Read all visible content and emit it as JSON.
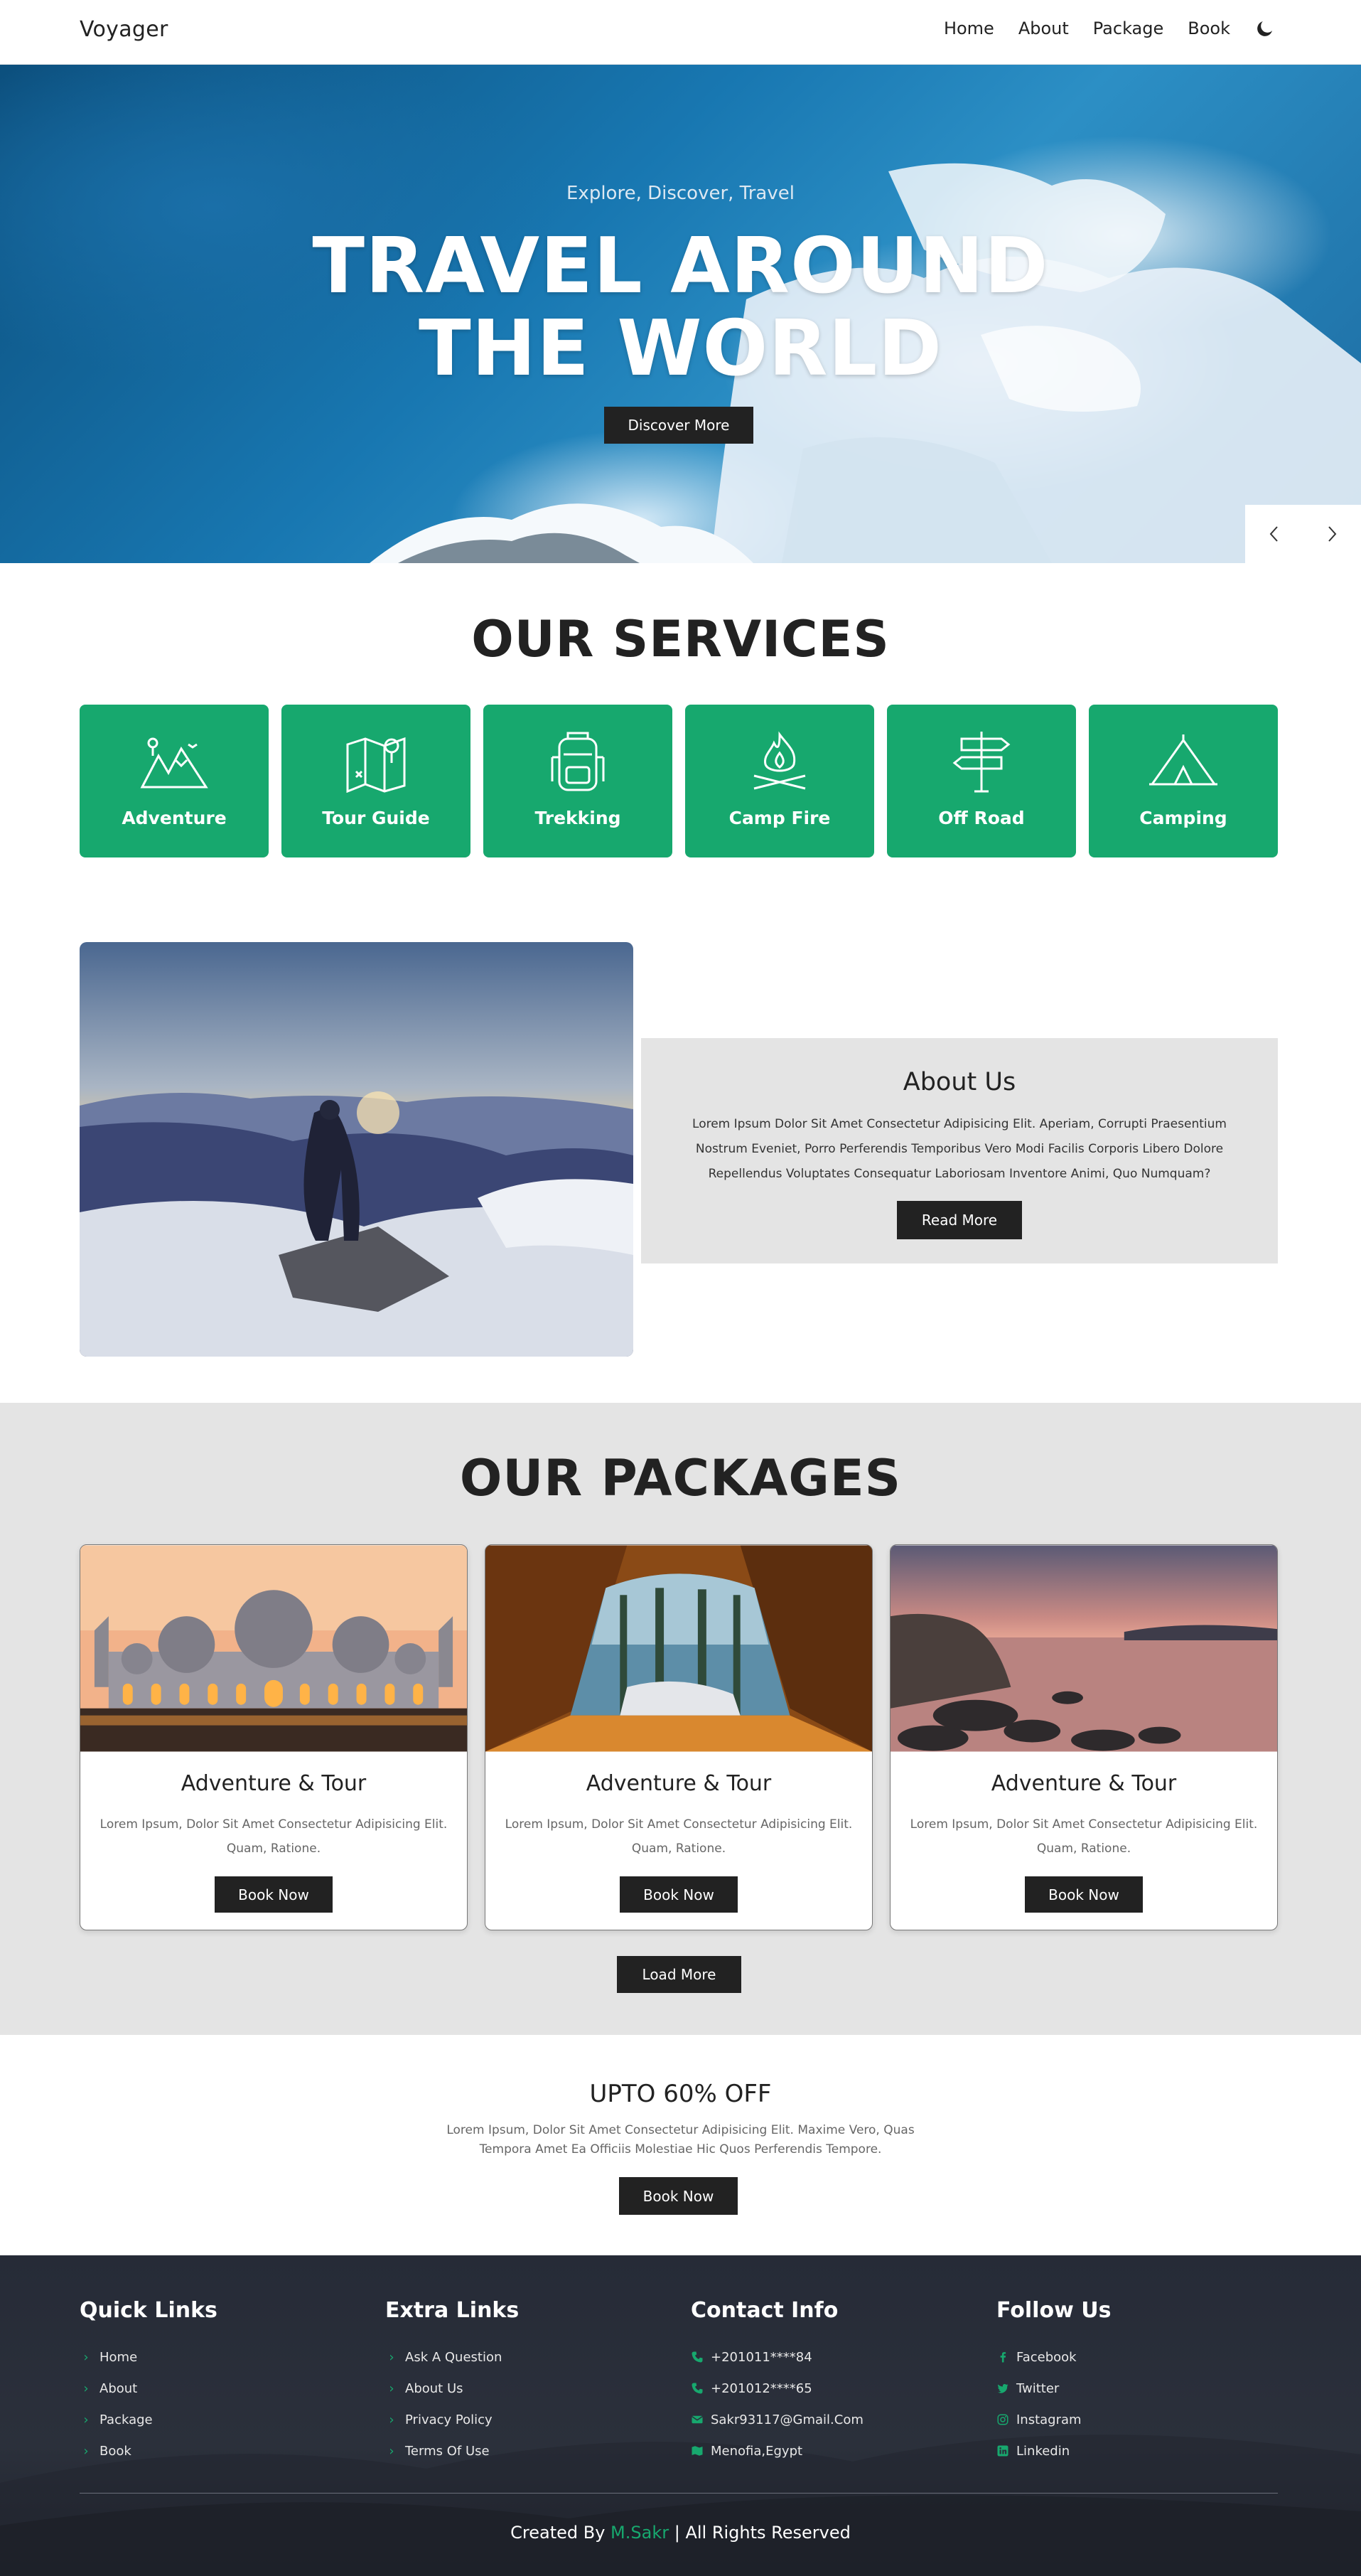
{
  "colors": {
    "accent": "#17a86e",
    "dark_button": "#222222",
    "footer_bg": "#2b303b",
    "section_gray": "#e4e4e4"
  },
  "nav": {
    "logo": "Voyager",
    "links": [
      "Home",
      "About",
      "Package",
      "Book"
    ],
    "theme_icon": "moon-icon"
  },
  "hero": {
    "subtitle": "Explore, Discover, Travel",
    "title_line1": "TRAVEL AROUND",
    "title_line2": "THE WORLD",
    "button": "Discover More",
    "prev_icon": "chevron-left-icon",
    "next_icon": "chevron-right-icon"
  },
  "services": {
    "title": "OUR SERVICES",
    "items": [
      {
        "label": "Adventure",
        "icon": "mountains-icon"
      },
      {
        "label": "Tour Guide",
        "icon": "map-pin-icon"
      },
      {
        "label": "Trekking",
        "icon": "backpack-icon"
      },
      {
        "label": "Camp Fire",
        "icon": "campfire-icon"
      },
      {
        "label": "Off Road",
        "icon": "signpost-icon"
      },
      {
        "label": "Camping",
        "icon": "tent-icon"
      }
    ]
  },
  "about": {
    "title": "About Us",
    "text": "Lorem Ipsum Dolor Sit Amet Consectetur Adipisicing Elit. Aperiam, Corrupti Praesentium Nostrum Eveniet, Porro Perferendis Temporibus Vero Modi Facilis Corporis Libero Dolore Repellendus Voluptates Consequatur Laboriosam Inventore Animi, Quo Numquam?",
    "button": "Read More"
  },
  "packages": {
    "title": "OUR PACKAGES",
    "items": [
      {
        "title": "Adventure & Tour",
        "desc": "Lorem Ipsum, Dolor Sit Amet Consectetur Adipisicing Elit. Quam, Ratione.",
        "button": "Book Now"
      },
      {
        "title": "Adventure & Tour",
        "desc": "Lorem Ipsum, Dolor Sit Amet Consectetur Adipisicing Elit. Quam, Ratione.",
        "button": "Book Now"
      },
      {
        "title": "Adventure & Tour",
        "desc": "Lorem Ipsum, Dolor Sit Amet Consectetur Adipisicing Elit. Quam, Ratione.",
        "button": "Book Now"
      }
    ],
    "load_more": "Load More"
  },
  "offer": {
    "title": "UPTO 60% OFF",
    "text": "Lorem Ipsum, Dolor Sit Amet Consectetur Adipisicing Elit. Maxime Vero, Quas Tempora Amet Ea Officiis Molestiae Hic Quos Perferendis Tempore.",
    "button": "Book Now"
  },
  "footer": {
    "quick_links": {
      "title": "Quick Links",
      "items": [
        "Home",
        "About",
        "Package",
        "Book"
      ]
    },
    "extra_links": {
      "title": "Extra Links",
      "items": [
        "Ask A Question",
        "About Us",
        "Privacy Policy",
        "Terms Of Use"
      ]
    },
    "contact": {
      "title": "Contact Info",
      "items": [
        {
          "text": "+201011****84",
          "icon": "phone-icon"
        },
        {
          "text": "+201012****65",
          "icon": "phone-icon"
        },
        {
          "text": "Sakr93117@Gmail.Com",
          "icon": "envelope-icon"
        },
        {
          "text": "Menofia,Egypt",
          "icon": "map-icon"
        }
      ]
    },
    "follow": {
      "title": "Follow Us",
      "items": [
        {
          "text": "Facebook",
          "icon": "facebook-icon"
        },
        {
          "text": "Twitter",
          "icon": "twitter-icon"
        },
        {
          "text": "Instagram",
          "icon": "instagram-icon"
        },
        {
          "text": "Linkedin",
          "icon": "linkedin-icon"
        }
      ]
    },
    "credit_prefix": "Created By",
    "credit_author": "M.Sakr",
    "credit_suffix": "| All Rights Reserved"
  }
}
